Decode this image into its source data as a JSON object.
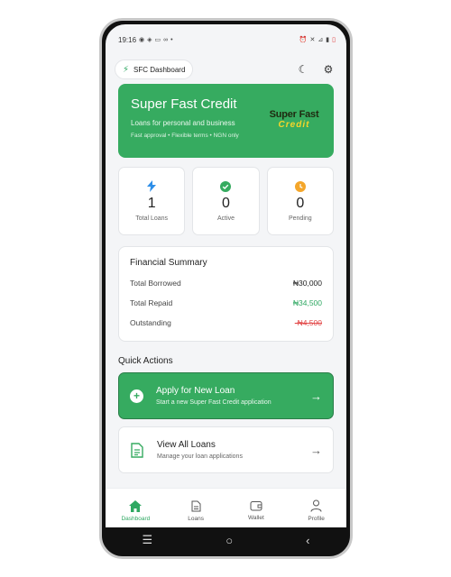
{
  "status_bar": {
    "time": "19:16",
    "left_icons": [
      "whatsapp-icon",
      "location-icon",
      "message-icon",
      "glasses-icon",
      "dot"
    ],
    "right_icons": [
      "alarm-icon",
      "mute-icon",
      "signal-4g-icon",
      "signal-bars-icon",
      "battery-icon"
    ]
  },
  "topbar": {
    "app_label": "SFC Dashboard",
    "dark_mode_icon": "moon-icon",
    "settings_icon": "gear-icon"
  },
  "hero": {
    "title": "Super Fast Credit",
    "subtitle": "Loans for personal and business",
    "meta": "Fast approval • Flexible terms • NGN only",
    "logo_line1": "Super Fast",
    "logo_line2": "Credit"
  },
  "stats": [
    {
      "icon": "bolt-icon",
      "value": "1",
      "label": "Total Loans"
    },
    {
      "icon": "check-circle-icon",
      "value": "0",
      "label": "Active"
    },
    {
      "icon": "clock-icon",
      "value": "0",
      "label": "Pending"
    }
  ],
  "summary": {
    "title": "Financial Summary",
    "rows": [
      {
        "label": "Total Borrowed",
        "value": "₦30,000"
      },
      {
        "label": "Total Repaid",
        "value": "₦34,500"
      },
      {
        "label": "Outstanding",
        "value": "-₦4,500"
      }
    ]
  },
  "quick_actions": {
    "title": "Quick Actions",
    "primary": {
      "title": "Apply for New Loan",
      "subtitle": "Start a new Super Fast Credit application"
    },
    "secondary": {
      "title": "View All Loans",
      "subtitle": "Manage your loan applications"
    }
  },
  "nav": {
    "items": [
      {
        "label": "Dashboard",
        "icon": "home-icon"
      },
      {
        "label": "Loans",
        "icon": "document-icon"
      },
      {
        "label": "Wallet",
        "icon": "wallet-icon"
      },
      {
        "label": "Profile",
        "icon": "user-icon"
      }
    ]
  },
  "colors": {
    "accent": "#36ab60",
    "positive": "#2fa862",
    "negative": "#e24747",
    "logo_gold": "#f5d52a"
  }
}
